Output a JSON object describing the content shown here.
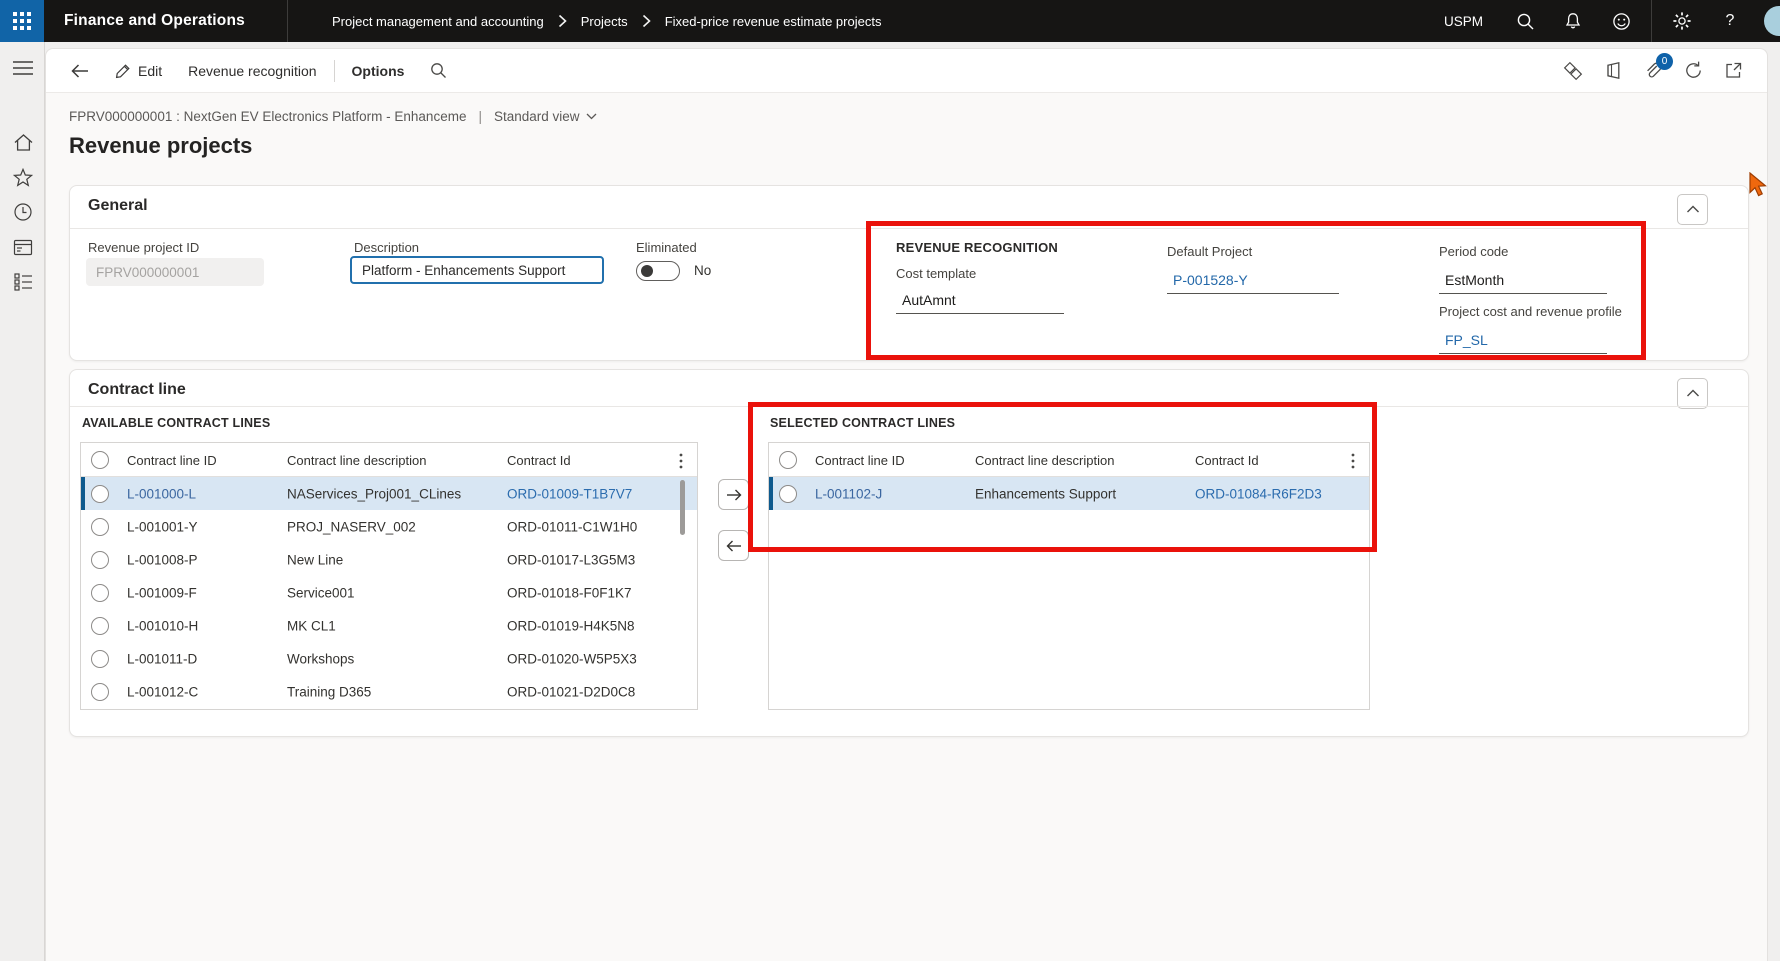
{
  "topbar": {
    "app_title": "Finance and Operations",
    "environment": "USPM"
  },
  "breadcrumb": [
    "Project management and accounting",
    "Projects",
    "Fixed-price revenue estimate projects"
  ],
  "action_bar": {
    "edit": "Edit",
    "revenue_recognition": "Revenue recognition",
    "options": "Options",
    "attachment_count": "0"
  },
  "record_header": {
    "id_title": "FPRV000000001 : NextGen EV Electronics Platform - Enhanceme",
    "separator": "|",
    "view": "Standard view"
  },
  "page_title": "Revenue projects",
  "general": {
    "header": "General",
    "revenue_project_id": {
      "label": "Revenue project ID",
      "value": "FPRV000000001"
    },
    "description": {
      "label": "Description",
      "value": "Platform - Enhancements Support"
    },
    "eliminated": {
      "label": "Eliminated",
      "value": "No"
    },
    "revenue_recognition": {
      "heading": "REVENUE RECOGNITION",
      "cost_template": {
        "label": "Cost template",
        "value": "AutAmnt"
      },
      "default_project": {
        "label": "Default Project",
        "value": "P-001528-Y"
      },
      "period_code": {
        "label": "Period code",
        "value": "EstMonth"
      },
      "project_cost_revenue_profile": {
        "label": "Project cost and revenue profile",
        "value": "FP_SL"
      }
    }
  },
  "contract_line": {
    "header": "Contract line",
    "available": {
      "title": "AVAILABLE CONTRACT LINES",
      "columns": [
        "Contract line ID",
        "Contract line description",
        "Contract Id"
      ],
      "rows": [
        {
          "id": "L-001000-L",
          "description": "NAServices_Proj001_CLines",
          "contract_id": "ORD-01009-T1B7V7",
          "selected": true
        },
        {
          "id": "L-001001-Y",
          "description": "PROJ_NASERV_002",
          "contract_id": "ORD-01011-C1W1H0",
          "selected": false
        },
        {
          "id": "L-001008-P",
          "description": "New Line",
          "contract_id": "ORD-01017-L3G5M3",
          "selected": false
        },
        {
          "id": "L-001009-F",
          "description": "Service001",
          "contract_id": "ORD-01018-F0F1K7",
          "selected": false
        },
        {
          "id": "L-001010-H",
          "description": "MK CL1",
          "contract_id": "ORD-01019-H4K5N8",
          "selected": false
        },
        {
          "id": "L-001011-D",
          "description": "Workshops",
          "contract_id": "ORD-01020-W5P5X3",
          "selected": false
        },
        {
          "id": "L-001012-C",
          "description": "Training D365",
          "contract_id": "ORD-01021-D2D0C8",
          "selected": false
        }
      ]
    },
    "selected": {
      "title": "SELECTED CONTRACT LINES",
      "columns": [
        "Contract line ID",
        "Contract line description",
        "Contract Id"
      ],
      "rows": [
        {
          "id": "L-001102-J",
          "description": "Enhancements Support",
          "contract_id": "ORD-01084-R6F2D3",
          "selected": true
        }
      ]
    }
  },
  "colors": {
    "brand_blue": "#1164a7",
    "link_blue": "#2b6cae",
    "selected_row_bg": "#d8e6f3",
    "selected_row_accent": "#0e5a8e",
    "annotation_red": "#ea120b",
    "topbar_bg": "#161514"
  }
}
